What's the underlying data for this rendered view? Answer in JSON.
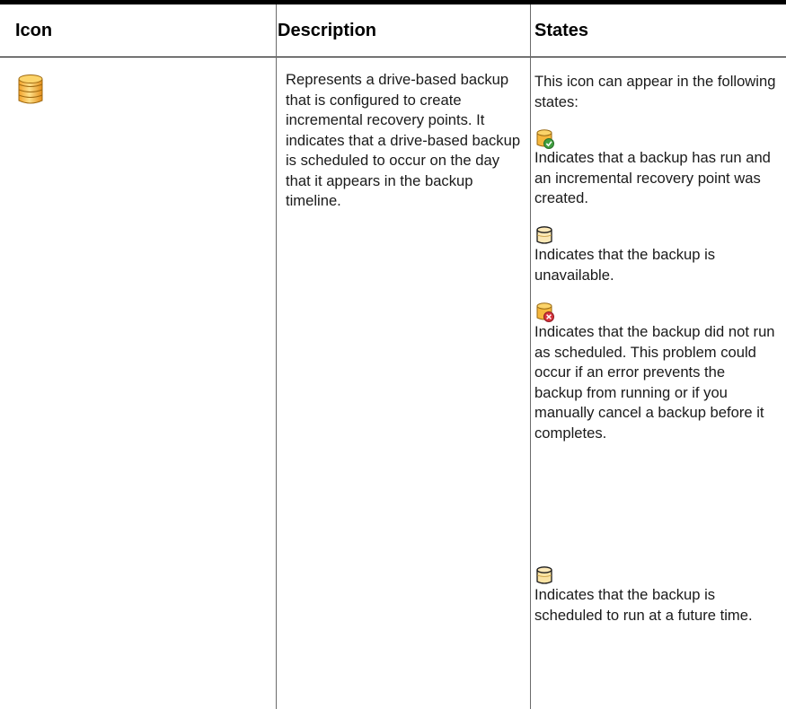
{
  "table": {
    "headers": [
      "Icon",
      "Description",
      "States"
    ],
    "main_icon": "database-incremental-icon",
    "description": "Represents a drive-based backup that is configured to create incremental recovery points. It indicates that a drive-based backup is scheduled to occur on the day that it appears in the backup timeline.",
    "states_intro": "This icon can appear in the following states:",
    "states": [
      {
        "icon": "database-success-icon",
        "text": "Indicates that a backup has run and an incremental recovery point was created."
      },
      {
        "icon": "database-unavailable-icon",
        "text": "Indicates that the backup is unavailable."
      },
      {
        "icon": "database-error-icon",
        "text": "Indicates that the backup did not run as scheduled. This problem could occur if an error prevents the backup from running or if you manually cancel a backup before it completes."
      },
      {
        "icon": "database-scheduled-icon",
        "text": "Indicates that the backup is scheduled to run at a future time."
      }
    ],
    "colors": {
      "rule": "#000000",
      "column_divider": "#6b6b6b",
      "db_fill": "#f6b73c",
      "db_stroke": "#9a6a12",
      "success": "#3f9f3f",
      "error": "#d8323c"
    }
  }
}
